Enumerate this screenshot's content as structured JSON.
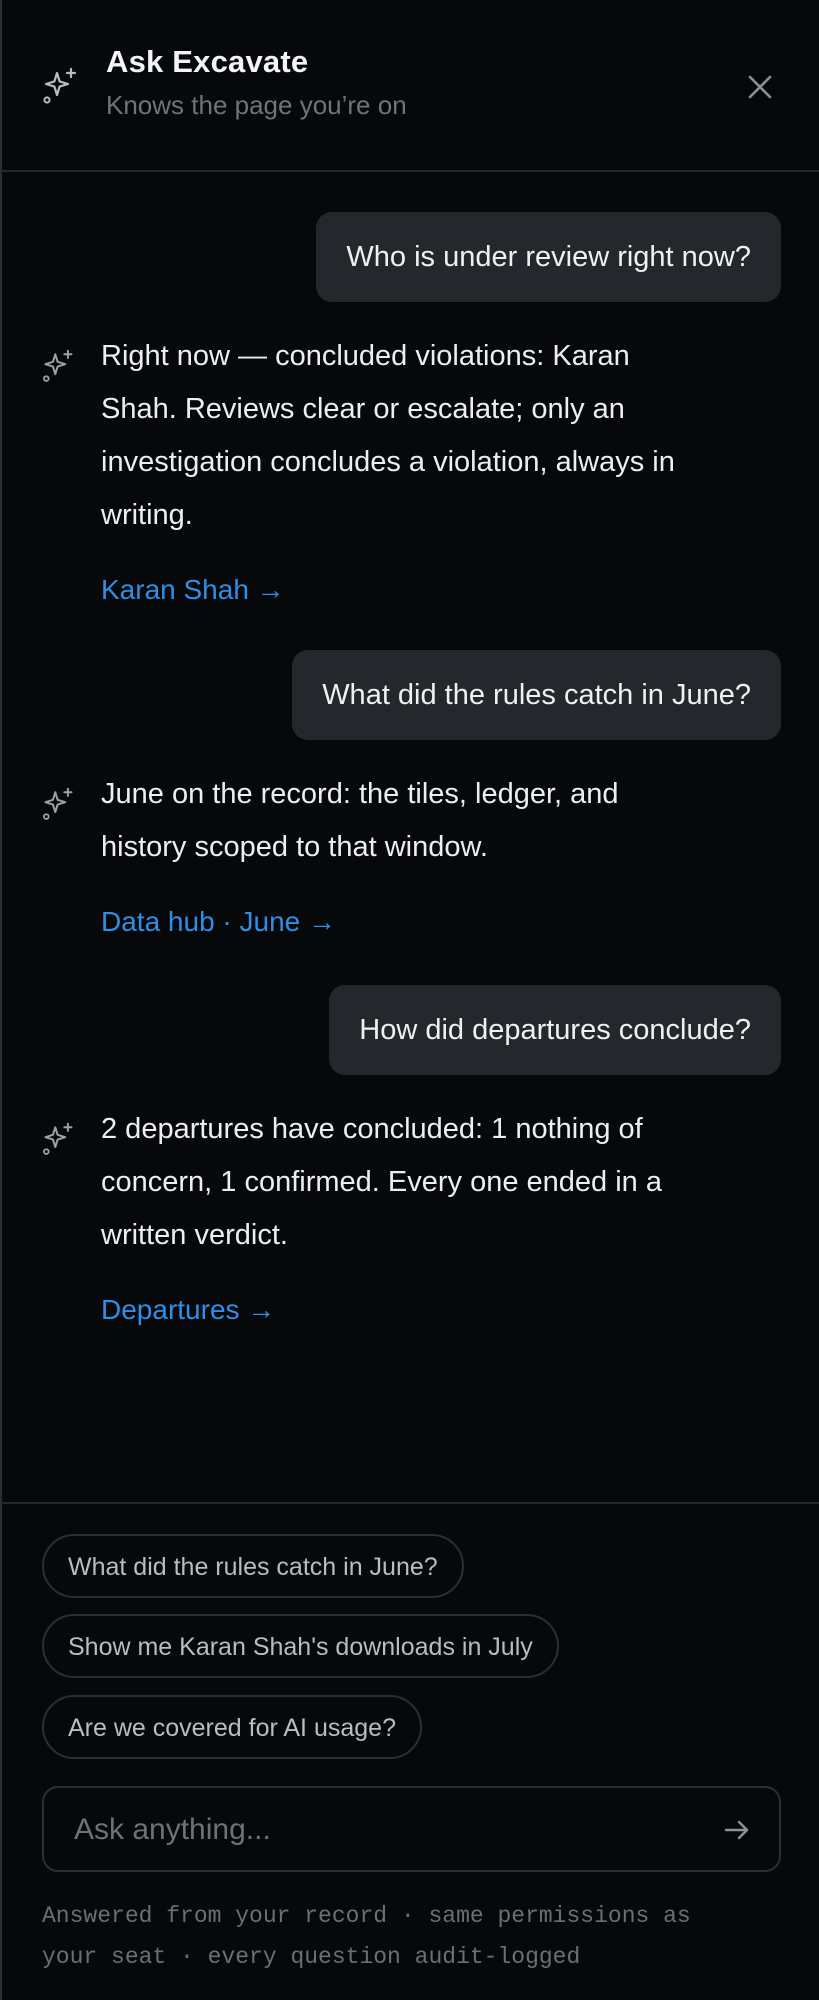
{
  "header": {
    "title": "Ask Excavate",
    "subtitle": "Knows the page you’re on"
  },
  "messages": [
    {
      "role": "user",
      "text": "Who is under review right now?"
    },
    {
      "role": "assistant",
      "lines": [
        "Right now — concluded violations: Karan",
        "Shah. Reviews clear or escalate; only an",
        "investigation concludes a violation, always in",
        "writing."
      ],
      "link": "Karan Shah →"
    },
    {
      "role": "user",
      "text": "What did the rules catch in June?"
    },
    {
      "role": "assistant",
      "lines": [
        "June on the record: the tiles, ledger, and",
        "history scoped to that window."
      ],
      "link": "Data hub · June →"
    },
    {
      "role": "user",
      "text": "How did departures conclude?"
    },
    {
      "role": "assistant",
      "lines": [
        "2 departures have concluded: 1 nothing of",
        "concern, 1 confirmed. Every one ended in a",
        "written verdict."
      ],
      "link": "Departures →"
    }
  ],
  "suggestions": [
    "What did the rules catch in June?",
    "Show me Karan Shah's downloads in July",
    "Are we covered for AI usage?"
  ],
  "input": {
    "placeholder": "Ask anything..."
  },
  "disclaimer": {
    "line1": "Answered from your record · same permissions as",
    "line2": "your seat · every question audit-logged"
  },
  "colors": {
    "background": "#07080a",
    "user_bubble": "#25272c",
    "link": "#2f8ee6",
    "muted_text": "#6f737b"
  }
}
